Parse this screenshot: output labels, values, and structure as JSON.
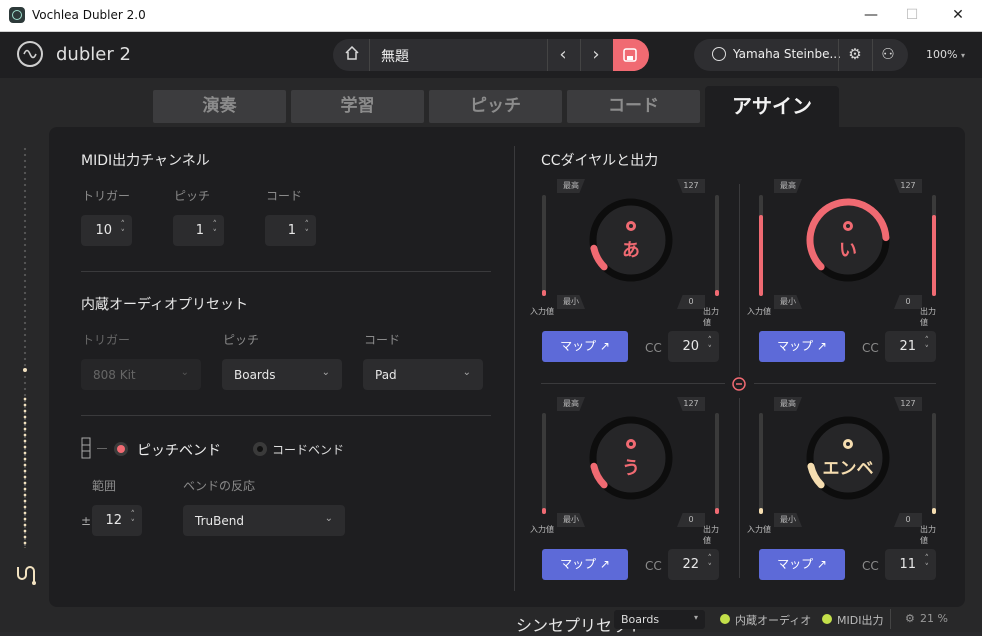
{
  "window": {
    "title": "Vochlea Dubler 2.0",
    "minimize": "—",
    "maximize": "☐",
    "close": "✕"
  },
  "header": {
    "logo": "dubler 2",
    "project_name": "無題",
    "prev": "‹",
    "next": "›",
    "device": "Yamaha Steinbe...",
    "zoom": "100%"
  },
  "tabs": [
    {
      "label": "演奏",
      "active": false
    },
    {
      "label": "学習",
      "active": false
    },
    {
      "label": "ピッチ",
      "active": false
    },
    {
      "label": "コード",
      "active": false
    },
    {
      "label": "アサイン",
      "active": true
    }
  ],
  "midi": {
    "title": "MIDI出力チャンネル",
    "trigger_label": "トリガー",
    "trigger_value": "10",
    "pitch_label": "ピッチ",
    "pitch_value": "1",
    "chord_label": "コード",
    "chord_value": "1"
  },
  "presets": {
    "title": "内蔵オーディオプリセット",
    "trigger_label": "トリガー",
    "trigger_value": "808 Kit",
    "pitch_label": "ピッチ",
    "pitch_value": "Boards",
    "chord_label": "コード",
    "chord_value": "Pad"
  },
  "bend": {
    "pitch_bend_label": "ピッチベンド",
    "chord_bend_label": "コードベンド",
    "range_label": "範囲",
    "range_prefix": "±",
    "range_value": "12",
    "response_label": "ベンドの反応",
    "response_value": "TruBend"
  },
  "cc": {
    "title": "CCダイヤルと出力",
    "max_label": "最高",
    "min_label": "最小",
    "max_value": "127",
    "min_value": "0",
    "input_label": "入力値",
    "output_label": "出力値",
    "map_label": "マップ ↗",
    "cc_label": "CC",
    "knobs": [
      {
        "name": "あ",
        "cc": "20",
        "level": 0.12,
        "color": "#f06a72"
      },
      {
        "name": "い",
        "cc": "21",
        "level": 0.82,
        "color": "#f06a72"
      },
      {
        "name": "う",
        "cc": "22",
        "level": 0.12,
        "color": "#f06a72"
      },
      {
        "name": "エンベ",
        "cc": "11",
        "level": 0.12,
        "color": "#f5ddb0"
      }
    ]
  },
  "status": {
    "synth_preset_label": "シンセプリセット",
    "synth_preset_value": "Boards",
    "internal_audio_label": "内蔵オーディオ",
    "midi_out_label": "MIDI出力",
    "cpu": "21 %",
    "accent": "#c4e04a"
  }
}
